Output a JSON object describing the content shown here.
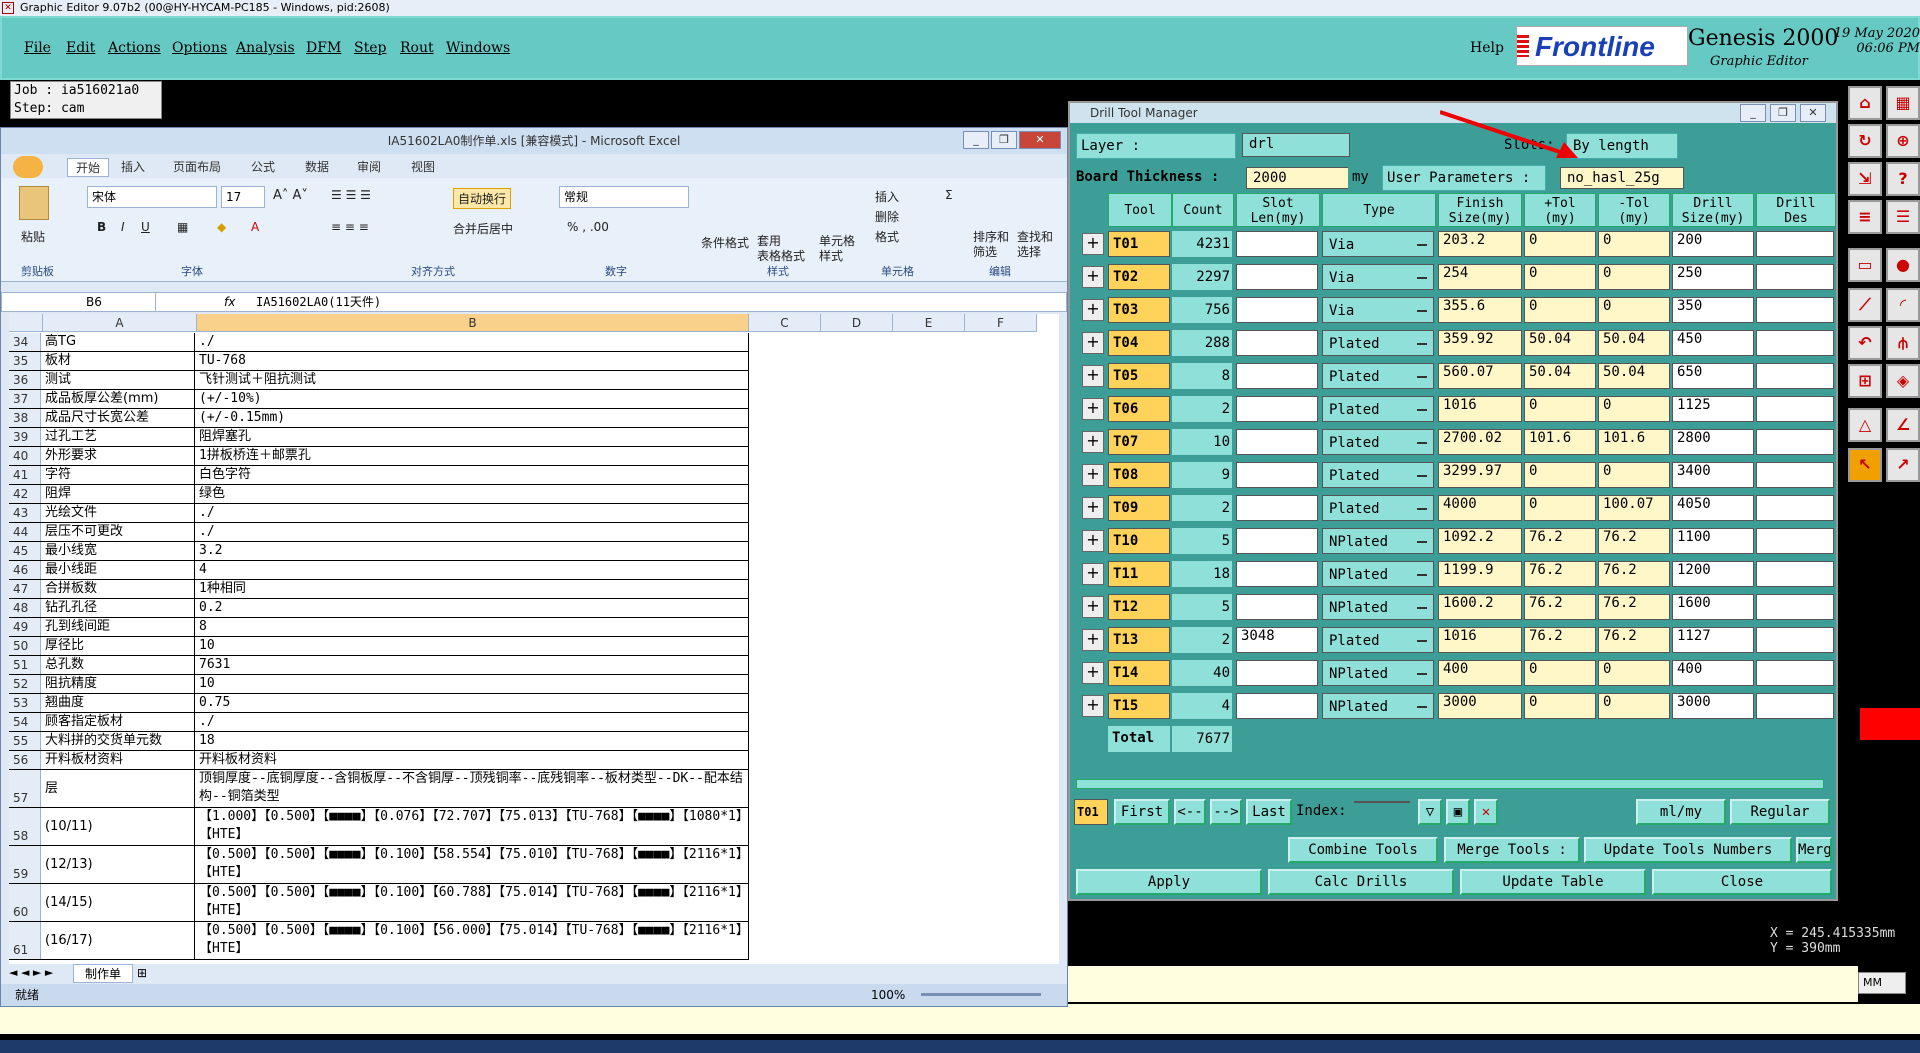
{
  "genesis": {
    "title_bar": "Graphic Editor 9.07b2 (00@HY-HYCAM-PC185 - Windows, pid:2608)",
    "menu": [
      "File",
      "Edit",
      "Actions",
      "Options",
      "Analysis",
      "DFM",
      "Step",
      "Rout",
      "Windows"
    ],
    "help": "Help",
    "logo": "Frontline",
    "product": "Genesis 2000",
    "subtitle": "Graphic Editor",
    "date": "19 May 2020",
    "time": "06:06 PM",
    "job": "Job : ia516021a0",
    "step": "Step: cam",
    "coord_x": "X = 245.415335mm",
    "coord_y": "Y =    390mm",
    "units": "MM"
  },
  "excel": {
    "title": "IA51602LA0制作单.xls [兼容模式] - Microsoft Excel",
    "tabs": [
      "开始",
      "插入",
      "页面布局",
      "公式",
      "数据",
      "审阅",
      "视图"
    ],
    "ribbon": {
      "paste": "粘贴",
      "clipboard": "剪贴板",
      "font_name": "宋体",
      "font_size": "17",
      "font_group": "字体",
      "wrap": "自动换行",
      "merge": "合并后居中",
      "align_group": "对齐方式",
      "number_format": "常规",
      "number_group": "数字",
      "cond_format": "条件格式",
      "table_format": "套用\n表格格式",
      "cell_style": "单元格\n样式",
      "style_group": "样式",
      "insert": "插入",
      "delete": "删除",
      "format": "格式",
      "cells_group": "单元格",
      "sort": "排序和\n筛选",
      "find": "查找和\n选择",
      "edit_group": "编辑"
    },
    "cell_ref": "B6",
    "formula": "IA51602LA0(11天件)",
    "columns": [
      "A",
      "B",
      "C",
      "D",
      "E",
      "F"
    ],
    "rows": [
      {
        "n": "34",
        "a": "高TG",
        "b": "./"
      },
      {
        "n": "35",
        "a": "板材",
        "b": "TU-768"
      },
      {
        "n": "36",
        "a": "测试",
        "b": "飞针测试＋阻抗测试"
      },
      {
        "n": "37",
        "a": "成品板厚公差(mm)",
        "b": "(+/-10%)"
      },
      {
        "n": "38",
        "a": "成品尺寸长宽公差",
        "b": "(+/-0.15mm)"
      },
      {
        "n": "39",
        "a": "过孔工艺",
        "b": "阻焊塞孔"
      },
      {
        "n": "40",
        "a": "外形要求",
        "b": "1拼板桥连＋邮票孔"
      },
      {
        "n": "41",
        "a": "字符",
        "b": "白色字符"
      },
      {
        "n": "42",
        "a": "阻焊",
        "b": "绿色"
      },
      {
        "n": "43",
        "a": "光绘文件",
        "b": "./"
      },
      {
        "n": "44",
        "a": "层压不可更改",
        "b": "./"
      },
      {
        "n": "45",
        "a": "最小线宽",
        "b": "3.2"
      },
      {
        "n": "46",
        "a": "最小线距",
        "b": "4"
      },
      {
        "n": "47",
        "a": "合拼板数",
        "b": "1种相同"
      },
      {
        "n": "48",
        "a": "钻孔孔径",
        "b": "0.2"
      },
      {
        "n": "49",
        "a": "孔到线间距",
        "b": "8"
      },
      {
        "n": "50",
        "a": "厚径比",
        "b": "10"
      },
      {
        "n": "51",
        "a": "总孔数",
        "b": "7631"
      },
      {
        "n": "52",
        "a": "阻抗精度",
        "b": "10"
      },
      {
        "n": "53",
        "a": "翘曲度",
        "b": "0.75"
      },
      {
        "n": "54",
        "a": "顾客指定板材",
        "b": "./"
      },
      {
        "n": "55",
        "a": "大料拼的交货单元数",
        "b": "18"
      },
      {
        "n": "56",
        "a": "开料板材资料",
        "b": "开料板材资料"
      },
      {
        "n": "57",
        "a": "层",
        "b": "顶铜厚度--底铜厚度--含铜板厚--不含铜厚--顶残铜率--底残铜率--板材类型--DK--配本结构--铜箔类型"
      },
      {
        "n": "58",
        "a": "(10/11)",
        "b": "【1.000】【0.500】【■■■■】【0.076】【72.707】【75.013】【TU-768】【■■■■】【1080*1】【HTE】"
      },
      {
        "n": "59",
        "a": "(12/13)",
        "b": "【0.500】【0.500】【■■■■】【0.100】【58.554】【75.010】【TU-768】【■■■■】【2116*1】【HTE】"
      },
      {
        "n": "60",
        "a": "(14/15)",
        "b": "【0.500】【0.500】【■■■■】【0.100】【60.788】【75.014】【TU-768】【■■■■】【2116*1】【HTE】"
      },
      {
        "n": "61",
        "a": "(16/17)",
        "b": "【0.500】【0.500】【■■■■】【0.100】【56.000】【75.014】【TU-768】【■■■■】【2116*1】【HTE】"
      }
    ],
    "sheet": "制作单",
    "status": "就绪",
    "zoom": "100%"
  },
  "drill": {
    "title": "Drill Tool Manager",
    "layer_label": "Layer             :",
    "layer": "drl",
    "slots_label": "Slots:",
    "slots": "By length",
    "thickness_label": "Board Thickness :",
    "thickness": "2000",
    "thickness_unit": "my",
    "user_params_label": "User Parameters :",
    "user_params": "no_hasl_25g",
    "headers": [
      "Tool",
      "Count",
      "Slot\nLen(my)",
      "Type",
      "Finish\nSize(my)",
      "+Tol\n(my)",
      "-Tol\n(my)",
      "Drill\nSize(my)",
      "Drill\nDes"
    ],
    "tools": [
      {
        "tool": "T01",
        "count": "4231",
        "slot": "",
        "type": "Via",
        "finish": "203.2",
        "ptol": "0",
        "mtol": "0",
        "drill": "200"
      },
      {
        "tool": "T02",
        "count": "2297",
        "slot": "",
        "type": "Via",
        "finish": "254",
        "ptol": "0",
        "mtol": "0",
        "drill": "250"
      },
      {
        "tool": "T03",
        "count": "756",
        "slot": "",
        "type": "Via",
        "finish": "355.6",
        "ptol": "0",
        "mtol": "0",
        "drill": "350"
      },
      {
        "tool": "T04",
        "count": "288",
        "slot": "",
        "type": "Plated",
        "finish": "359.92",
        "ptol": "50.04",
        "mtol": "50.04",
        "drill": "450"
      },
      {
        "tool": "T05",
        "count": "8",
        "slot": "",
        "type": "Plated",
        "finish": "560.07",
        "ptol": "50.04",
        "mtol": "50.04",
        "drill": "650"
      },
      {
        "tool": "T06",
        "count": "2",
        "slot": "",
        "type": "Plated",
        "finish": "1016",
        "ptol": "0",
        "mtol": "0",
        "drill": "1125"
      },
      {
        "tool": "T07",
        "count": "10",
        "slot": "",
        "type": "Plated",
        "finish": "2700.02",
        "ptol": "101.6",
        "mtol": "101.6",
        "drill": "2800"
      },
      {
        "tool": "T08",
        "count": "9",
        "slot": "",
        "type": "Plated",
        "finish": "3299.97",
        "ptol": "0",
        "mtol": "0",
        "drill": "3400"
      },
      {
        "tool": "T09",
        "count": "2",
        "slot": "",
        "type": "Plated",
        "finish": "4000",
        "ptol": "0",
        "mtol": "100.07",
        "drill": "4050"
      },
      {
        "tool": "T10",
        "count": "5",
        "slot": "",
        "type": "NPlated",
        "finish": "1092.2",
        "ptol": "76.2",
        "mtol": "76.2",
        "drill": "1100"
      },
      {
        "tool": "T11",
        "count": "18",
        "slot": "",
        "type": "NPlated",
        "finish": "1199.9",
        "ptol": "76.2",
        "mtol": "76.2",
        "drill": "1200"
      },
      {
        "tool": "T12",
        "count": "5",
        "slot": "",
        "type": "NPlated",
        "finish": "1600.2",
        "ptol": "76.2",
        "mtol": "76.2",
        "drill": "1600"
      },
      {
        "tool": "T13",
        "count": "2",
        "slot": "3048",
        "type": "Plated",
        "finish": "1016",
        "ptol": "76.2",
        "mtol": "76.2",
        "drill": "1127"
      },
      {
        "tool": "T14",
        "count": "40",
        "slot": "",
        "type": "NPlated",
        "finish": "400",
        "ptol": "0",
        "mtol": "0",
        "drill": "400"
      },
      {
        "tool": "T15",
        "count": "4",
        "slot": "",
        "type": "NPlated",
        "finish": "3000",
        "ptol": "0",
        "mtol": "0",
        "drill": "3000"
      }
    ],
    "total_label": "Total",
    "total": "7677",
    "nav": {
      "current": "T01",
      "first": "First",
      "prev": "<--",
      "next": "-->",
      "last": "Last",
      "index": "Index:",
      "unit": "ml/my",
      "mode": "Regular"
    },
    "actions": {
      "combine": "Combine Tools",
      "merge_tools": "Merge Tools :",
      "update_nums": "Update Tools Numbers",
      "merge": "Merge"
    },
    "bottom": {
      "apply": "Apply",
      "calc": "Calc Drills",
      "update": "Update Table",
      "close": "Close"
    }
  }
}
